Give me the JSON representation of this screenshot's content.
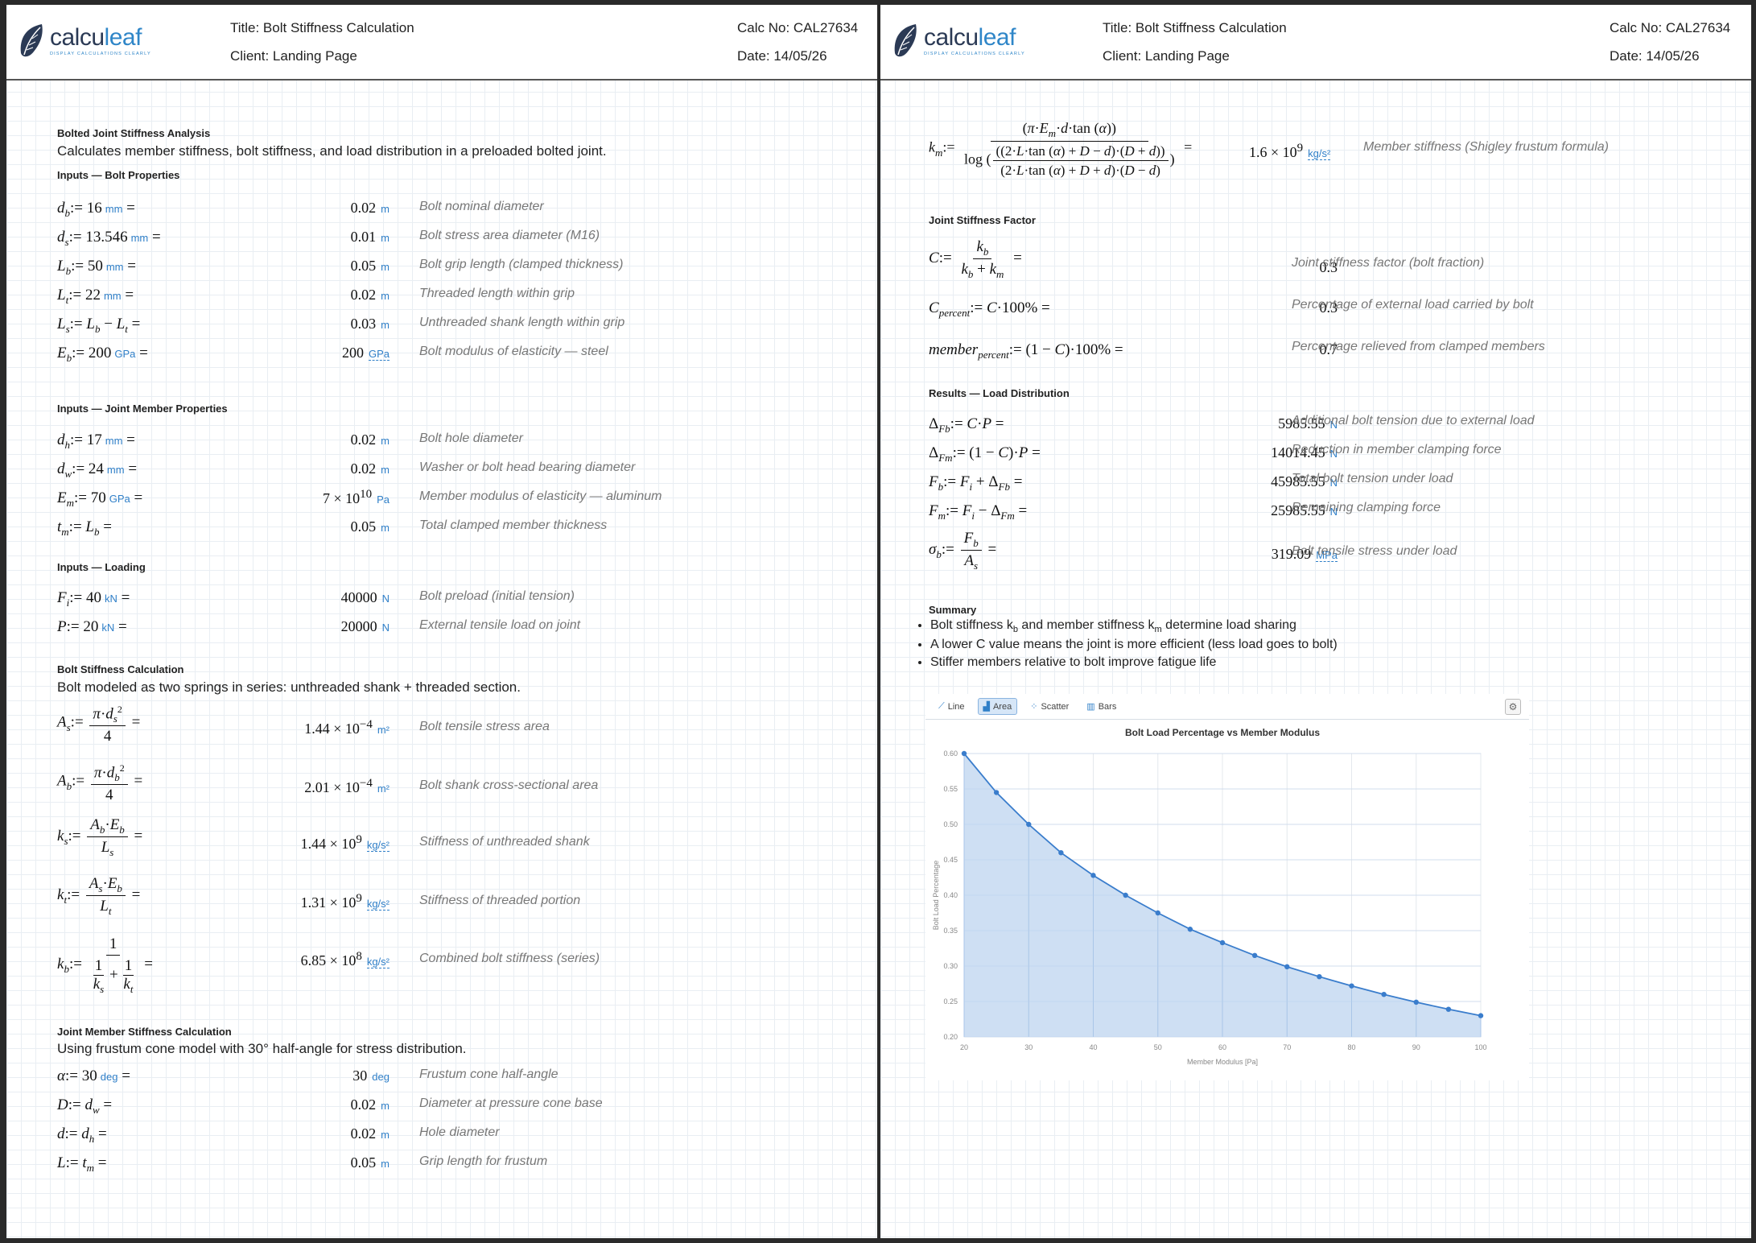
{
  "header": {
    "logo_name_a": "calcu",
    "logo_name_b": "leaf",
    "logo_tagline": "DISPLAY CALCULATIONS CLEARLY",
    "title": "Title: Bolt Stiffness Calculation",
    "client": "Client: Landing Page",
    "calc_no": "Calc No: CAL27634",
    "date": "Date: 14/05/26"
  },
  "colors": {
    "accent": "#2f7fc8",
    "logo_dark": "#2b3a55",
    "chart_fill": "#c9dcf2",
    "chart_line": "#3a7dcc"
  },
  "left": {
    "intro_title": "Bolted Joint Stiffness Analysis",
    "intro_text": "Calculates member stiffness, bolt stiffness, and load distribution in a preloaded bolted joint.",
    "bolt_props_title": "Inputs — Bolt Properties",
    "bolt_props": [
      {
        "sym": "d",
        "sub": "b",
        "expr": "16",
        "unit": "mm",
        "value": "0.02",
        "vunit": "m",
        "desc": "Bolt nominal diameter"
      },
      {
        "sym": "d",
        "sub": "s",
        "expr": "13.546",
        "unit": "mm",
        "value": "0.01",
        "vunit": "m",
        "desc": "Bolt stress area diameter (M16)"
      },
      {
        "sym": "L",
        "sub": "b",
        "expr": "50",
        "unit": "mm",
        "value": "0.05",
        "vunit": "m",
        "desc": "Bolt grip length (clamped thickness)"
      },
      {
        "sym": "L",
        "sub": "t",
        "expr": "22",
        "unit": "mm",
        "value": "0.02",
        "vunit": "m",
        "desc": "Threaded length within grip"
      },
      {
        "sym": "L",
        "sub": "s",
        "value": "0.03",
        "vunit": "m",
        "desc": "Unthreaded shank length within grip"
      },
      {
        "sym": "E",
        "sub": "b",
        "expr": "200",
        "unit": "GPa",
        "value": "200",
        "vunit": "GPa",
        "desc": "Bolt modulus of elasticity — steel"
      }
    ],
    "member_props_title": "Inputs — Joint Member Properties",
    "member_props": [
      {
        "sym": "d",
        "sub": "h",
        "expr": "17",
        "unit": "mm",
        "value": "0.02",
        "vunit": "m",
        "desc": "Bolt hole diameter"
      },
      {
        "sym": "d",
        "sub": "w",
        "expr": "24",
        "unit": "mm",
        "value": "0.02",
        "vunit": "m",
        "desc": "Washer or bolt head bearing diameter"
      },
      {
        "sym": "E",
        "sub": "m",
        "expr": "70",
        "unit": "GPa",
        "value": "7 × 10",
        "vexp": "10",
        "vunit": "Pa",
        "desc": "Member modulus of elasticity — aluminum"
      },
      {
        "sym": "t",
        "sub": "m",
        "value": "0.05",
        "vunit": "m",
        "desc": "Total clamped member thickness"
      }
    ],
    "loading_title": "Inputs — Loading",
    "loading": [
      {
        "sym": "F",
        "sub": "i",
        "expr": "40",
        "unit": "kN",
        "value": "40000",
        "vunit": "N",
        "desc": "Bolt preload (initial tension)"
      },
      {
        "sym": "P",
        "expr": "20",
        "unit": "kN",
        "value": "20000",
        "vunit": "N",
        "desc": "External tensile load on joint"
      }
    ],
    "bolt_stiff_title": "Bolt Stiffness Calculation",
    "bolt_stiff_text": "Bolt modeled as two springs in series: unthreaded shank + threaded section.",
    "bolt_stiff": [
      {
        "value": "1.44 × 10",
        "vexp": "−4",
        "vunit": "m²",
        "desc": "Bolt tensile stress area"
      },
      {
        "value": "2.01 × 10",
        "vexp": "−4",
        "vunit": "m²",
        "desc": "Bolt shank cross-sectional area"
      },
      {
        "value": "1.44 × 10",
        "vexp": "9",
        "vunit": "kg/s²",
        "desc": "Stiffness of unthreaded shank"
      },
      {
        "value": "1.31 × 10",
        "vexp": "9",
        "vunit": "kg/s²",
        "desc": "Stiffness of threaded portion"
      },
      {
        "value": "6.85 × 10",
        "vexp": "8",
        "vunit": "kg/s²",
        "desc": "Combined bolt stiffness (series)"
      }
    ],
    "frustum_title": "Joint Member Stiffness Calculation",
    "frustum_text": "Using frustum cone model with 30° half-angle for stress distribution.",
    "frustum": [
      {
        "sym": "α",
        "expr": "30",
        "unit": "deg",
        "value": "30",
        "vunit": "deg",
        "desc": "Frustum cone half-angle"
      },
      {
        "sym": "D",
        "value": "0.02",
        "vunit": "m",
        "desc": "Diameter at pressure cone base"
      },
      {
        "sym": "d",
        "value": "0.02",
        "vunit": "m",
        "desc": "Hole diameter"
      },
      {
        "sym": "L",
        "value": "0.05",
        "vunit": "m",
        "desc": "Grip length for frustum"
      }
    ]
  },
  "right": {
    "km": {
      "value": "1.6 × 10",
      "vexp": "9",
      "vunit": "kg/s²",
      "desc": "Member stiffness (Shigley frustum formula)"
    },
    "jsf_title": "Joint Stiffness Factor",
    "jsf": [
      {
        "value": "0.3",
        "desc": "Joint stiffness factor (bolt fraction)"
      },
      {
        "value": "0.3",
        "desc": "Percentage of external load carried by bolt"
      },
      {
        "value": "0.7",
        "desc": "Percentage relieved from clamped members"
      }
    ],
    "load_title": "Results — Load Distribution",
    "load": [
      {
        "value": "5985.55",
        "vunit": "N",
        "desc": "Additional bolt tension due to external load"
      },
      {
        "value": "14014.45",
        "vunit": "N",
        "desc": "Reduction in member clamping force"
      },
      {
        "value": "45985.55",
        "vunit": "N",
        "desc": "Total bolt tension under load"
      },
      {
        "value": "25985.55",
        "vunit": "N",
        "desc": "Remaining clamping force"
      },
      {
        "value": "319.09",
        "vunit": "MPa",
        "desc": "Bolt tensile stress under load"
      }
    ],
    "summary_title": "Summary",
    "summary": [
      {
        "a": "Bolt stiffness k",
        "sa": "b",
        "b": " and member stiffness k",
        "sb": "m",
        "c": " determine load sharing"
      },
      {
        "text": "A lower C value means the joint is more efficient (less load goes to bolt)"
      },
      {
        "text": "Stiffer members relative to bolt improve fatigue life"
      }
    ],
    "chart_toolbar": {
      "line": "Line",
      "area": "Area",
      "scatter": "Scatter",
      "bars": "Bars"
    }
  },
  "chart_data": {
    "type": "area",
    "title": "Bolt Load Percentage vs Member Modulus",
    "xlabel": "Member Modulus [Pa]",
    "ylabel": "Bolt Load Percentage",
    "x": [
      20,
      25,
      30,
      35,
      40,
      45,
      50,
      55,
      60,
      65,
      70,
      75,
      80,
      85,
      90,
      95,
      100
    ],
    "y": [
      0.6,
      0.545,
      0.5,
      0.46,
      0.428,
      0.4,
      0.375,
      0.352,
      0.333,
      0.315,
      0.299,
      0.285,
      0.272,
      0.26,
      0.249,
      0.239,
      0.23
    ],
    "xlim": [
      20,
      100
    ],
    "ylim": [
      0.2,
      0.6
    ],
    "xticks": [
      20,
      30,
      40,
      50,
      60,
      70,
      80,
      90,
      100
    ],
    "yticks": [
      "0.20",
      "0.25",
      "0.30",
      "0.35",
      "0.40",
      "0.45",
      "0.50",
      "0.55",
      "0.60"
    ],
    "grid": true,
    "legend": "none"
  }
}
